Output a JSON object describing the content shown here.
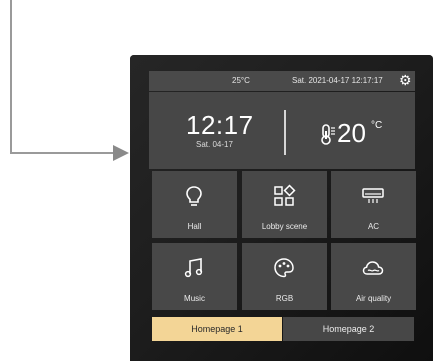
{
  "status_bar": {
    "temperature": "25°C",
    "datetime": "Sat. 2021-04-17 12:17:17",
    "settings_icon": "gear-icon"
  },
  "info_panel": {
    "time": "12:17",
    "date": "Sat. 04-17",
    "indoor_temperature": "20",
    "temperature_unit": "°C",
    "thermometer_icon": "thermometer-icon"
  },
  "tiles": [
    {
      "label": "Hall",
      "icon": "lightbulb-icon"
    },
    {
      "label": "Lobby scene",
      "icon": "scene-icon"
    },
    {
      "label": "AC",
      "icon": "air-conditioner-icon"
    },
    {
      "label": "Music",
      "icon": "music-note-icon"
    },
    {
      "label": "RGB",
      "icon": "palette-icon"
    },
    {
      "label": "Air quality",
      "icon": "air-quality-cloud-icon"
    }
  ],
  "pages": [
    {
      "label": "Homepage 1",
      "active": true
    },
    {
      "label": "Homepage 2",
      "active": false
    }
  ],
  "colors": {
    "active_tab": "#f3d596",
    "tile": "#484848",
    "panel": "#474747",
    "device_bg": "#1f1f1f"
  }
}
